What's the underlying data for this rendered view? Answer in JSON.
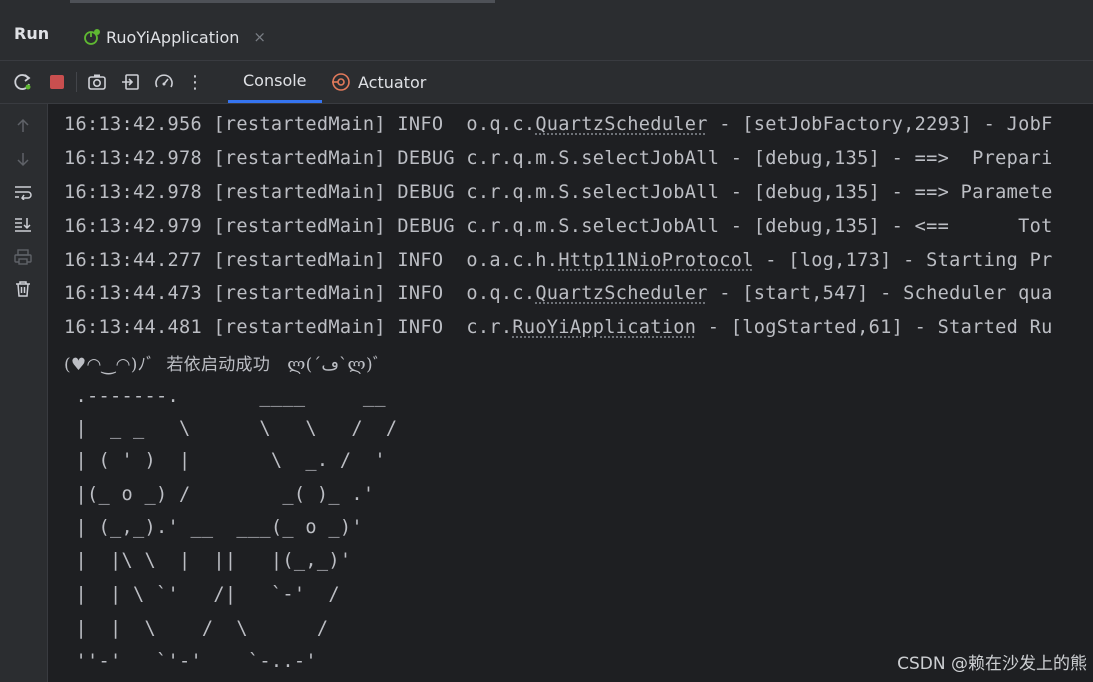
{
  "panel": {
    "title": "Run"
  },
  "run_tab": {
    "label": "RuoYiApplication",
    "close": "×"
  },
  "toolbar": {
    "icons": [
      "rerun-icon",
      "stop-icon",
      "screenshot-icon",
      "exit-icon",
      "dashboard-icon",
      "more-icon"
    ],
    "more_glyph": "⋮",
    "tabs": [
      {
        "label": "Console",
        "active": true
      },
      {
        "label": "Actuator",
        "active": false
      }
    ]
  },
  "gutter": {
    "icons": [
      "up-arrow-icon",
      "down-arrow-icon",
      "soft-wrap-icon",
      "scroll-to-end-icon",
      "print-icon",
      "trash-icon"
    ]
  },
  "log": [
    {
      "time": "16:13:42.956",
      "thread": "[restartedMain]",
      "level": "INFO ",
      "pkg": "o.q.c.",
      "cls": "QuartzScheduler",
      "msg": " - [setJobFactory,2293] - JobF"
    },
    {
      "time": "16:13:42.978",
      "thread": "[restartedMain]",
      "level": "DEBUG",
      "pkg": "c.r.q.m.S.selectJobAll",
      "cls": "",
      "msg": " - [debug,135] - ==>  Prepari"
    },
    {
      "time": "16:13:42.978",
      "thread": "[restartedMain]",
      "level": "DEBUG",
      "pkg": "c.r.q.m.S.selectJobAll",
      "cls": "",
      "msg": " - [debug,135] - ==> Paramete"
    },
    {
      "time": "16:13:42.979",
      "thread": "[restartedMain]",
      "level": "DEBUG",
      "pkg": "c.r.q.m.S.selectJobAll",
      "cls": "",
      "msg": " - [debug,135] - <==      Tot"
    },
    {
      "time": "16:13:44.277",
      "thread": "[restartedMain]",
      "level": "INFO ",
      "pkg": "o.a.c.h.",
      "cls": "Http11NioProtocol",
      "msg": " - [log,173] - Starting Pr"
    },
    {
      "time": "16:13:44.473",
      "thread": "[restartedMain]",
      "level": "INFO ",
      "pkg": "o.q.c.",
      "cls": "QuartzScheduler",
      "msg": " - [start,547] - Scheduler qua"
    },
    {
      "time": "16:13:44.481",
      "thread": "[restartedMain]",
      "level": "INFO ",
      "pkg": "c.r.",
      "cls": "RuoYiApplication",
      "msg": " - [logStarted,61] - Started Ru"
    }
  ],
  "success_line": "(♥◠‿◠)ﾉﾞ  若依启动成功   ლ(´ڡ`ლ)ﾞ",
  "ascii_art": [
    " .-------.       ____     __",
    " |  _ _   \\      \\   \\   /  /",
    " | ( ' )  |       \\  _. /  '",
    " |(_ o _) /        _( )_ .'",
    " | (_,_).' __  ___(_ o _)'",
    " |  |\\ \\  |  ||   |(_,_)'",
    " |  | \\ `'   /|   `-'  /",
    " |  |  \\    /  \\      /",
    " ''-'   `'-'    `-..-'"
  ],
  "watermark": "CSDN @赖在沙发上的熊",
  "colors": {
    "background": "#1e1f22",
    "panel": "#2b2d30",
    "accent": "#3574f0",
    "stop": "#c94f4f"
  }
}
